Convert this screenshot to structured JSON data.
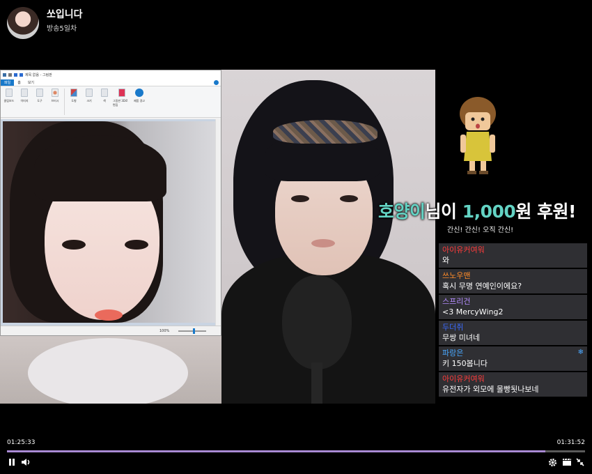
{
  "header": {
    "title": "쏘입니다",
    "subtitle": "방송5일차"
  },
  "paint": {
    "title": "제목 없음 - 그림판",
    "tabs": [
      "파일",
      "홈",
      "보기"
    ],
    "groups": [
      "클립보드",
      "이미지",
      "도구",
      "브러시",
      "도형",
      "크기",
      "색",
      "그림판 3D로 편집",
      "제품 경고"
    ],
    "zoom": "100%"
  },
  "donation": {
    "donor": "호양이",
    "mid": "님이 ",
    "amount": "1,000",
    "suffix": "원 후원!",
    "message": "간신! 간신! 오직 간신!"
  },
  "chat": {
    "messages": [
      {
        "user": "아이유커여워",
        "text": "와",
        "color": "#ff3b3b"
      },
      {
        "user": "쓰노우맨",
        "text": "혹시 무명 연예인이에요?",
        "color": "#ff8c2a"
      },
      {
        "user": "스프리건",
        "text": "<3 MercyWing2",
        "color": "#b48cff"
      },
      {
        "user": "두더쥐",
        "text": "무쌍 미녀네",
        "color": "#3b6bff"
      },
      {
        "user": "파랑은",
        "text": "키 150봅니다",
        "color": "#4aa8ff",
        "badge": "❄"
      },
      {
        "user": "아이유커여워",
        "text": "유전자가 외모에 몰빵됫나보네",
        "color": "#ff3b3b"
      }
    ]
  },
  "player": {
    "current_time": "01:25:33",
    "duration": "01:31:52",
    "progress": 0.9313,
    "accent": "#a98ad4"
  }
}
